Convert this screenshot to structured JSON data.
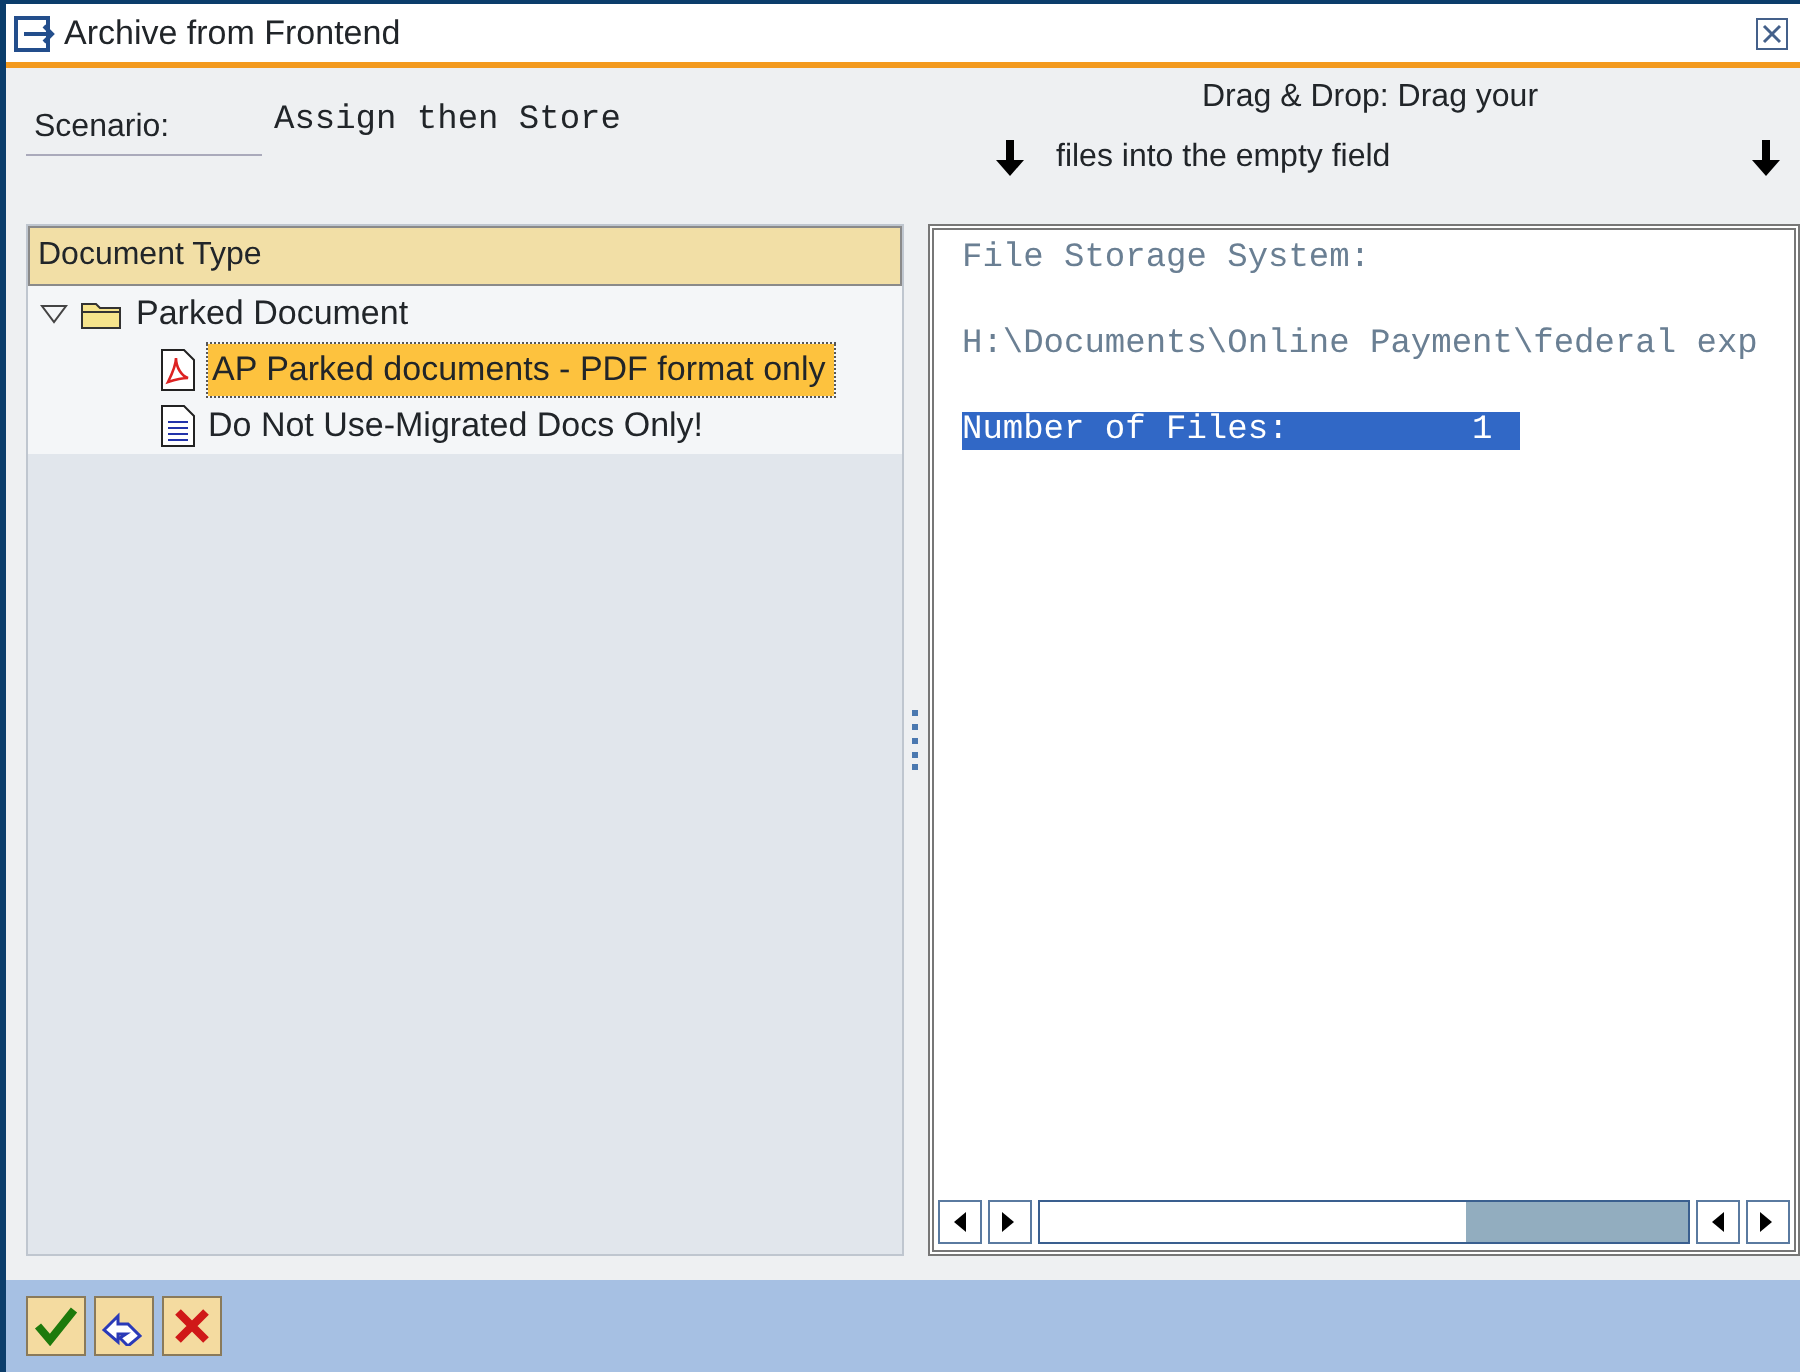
{
  "window": {
    "title": "Archive from Frontend"
  },
  "scenario": {
    "label": "Scenario:",
    "value": "Assign then Store"
  },
  "drop_hint": [
    "Drag & Drop: Drag your",
    "files into the empty field"
  ],
  "tree": {
    "header": "Document Type",
    "items": [
      {
        "label": "Parked Document",
        "kind": "folder",
        "expanded": true,
        "selected": false,
        "children": [
          {
            "label": "AP Parked documents - PDF format only",
            "kind": "pdf",
            "selected": true
          },
          {
            "label": "Do Not Use-Migrated Docs Only!",
            "kind": "doc",
            "selected": false
          }
        ]
      }
    ]
  },
  "storage": {
    "lines": [
      {
        "text": "File Storage System:",
        "selected": false
      },
      {
        "text": "H:\\Documents\\Online Payment\\federal exp",
        "selected": false
      },
      {
        "text": "Number of Files:         1",
        "selected": true
      }
    ]
  },
  "buttons": [
    {
      "kind": "confirm"
    },
    {
      "kind": "back"
    },
    {
      "kind": "cancel"
    }
  ]
}
